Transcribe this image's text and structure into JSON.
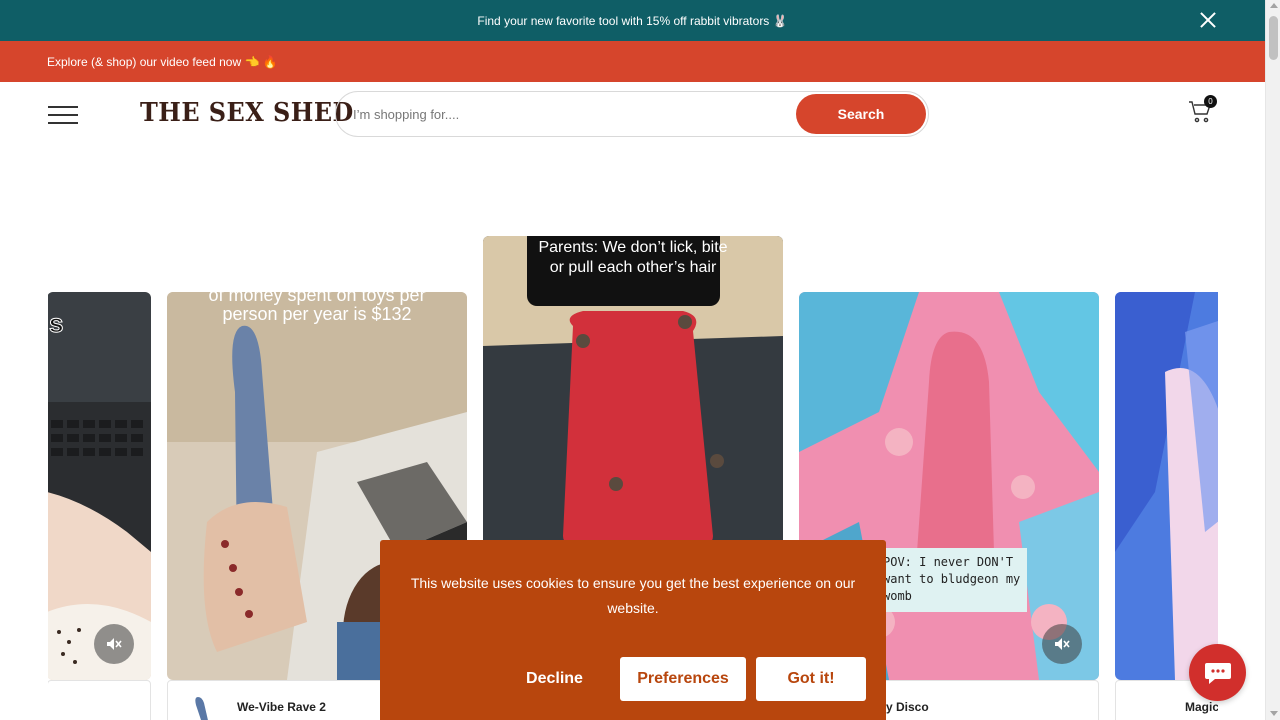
{
  "announcement": {
    "text": "Find your new favorite tool with 15% off rabbit vibrators 🐰"
  },
  "promo": {
    "text": "Explore (& shop) our video feed now 👈 🔥"
  },
  "header": {
    "logo": "THE SEX SHED",
    "search_placeholder": "I’m shopping for....",
    "search_button": "Search",
    "cart_count": "0"
  },
  "videos": [
    {
      "caption": "s",
      "product": ""
    },
    {
      "caption": "of money spent on toys per person per year is $132",
      "product": "We-Vibe Rave 2"
    },
    {
      "caption": "Parents: We don’t lick, bite or pull each other’s hair",
      "product": ""
    },
    {
      "caption": "POV: I never DON'T want to bludgeon my womb",
      "product": "y Disco"
    },
    {
      "caption": "",
      "product": "Magic"
    }
  ],
  "cookie": {
    "message": "This website uses cookies to ensure you get the best experience on our website.",
    "decline": "Decline",
    "preferences": "Preferences",
    "accept": "Got it!"
  },
  "colors": {
    "announcement_bg": "#0f5e66",
    "brand_red": "#d6452c",
    "cookie_bg": "#b8460d",
    "chat_bg": "#d12f2c"
  },
  "icons": [
    "close-icon",
    "hamburger-icon",
    "cart-icon",
    "muted-speaker-icon",
    "chat-icon"
  ]
}
